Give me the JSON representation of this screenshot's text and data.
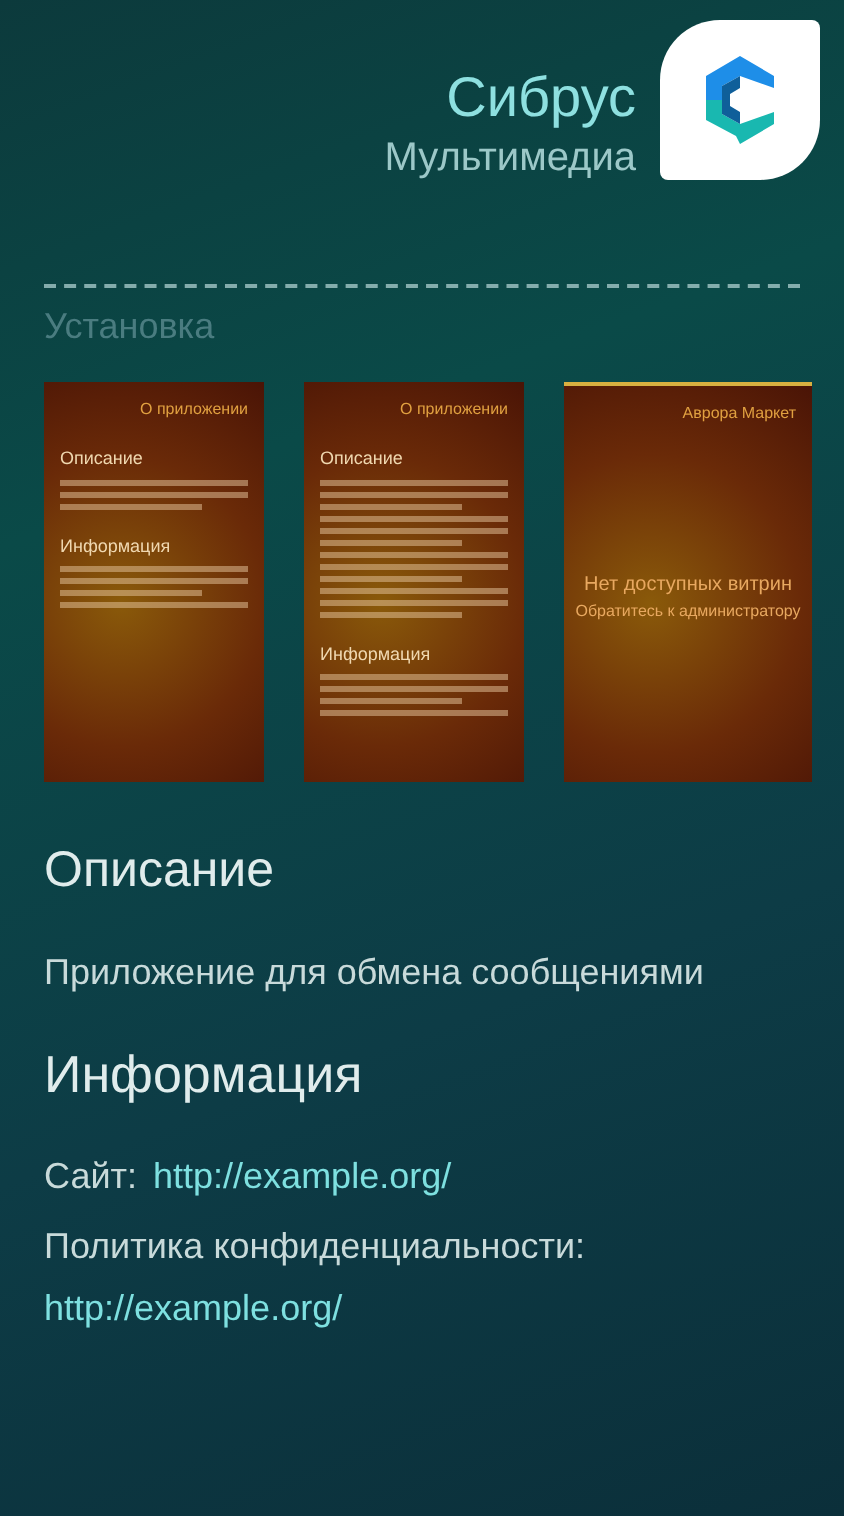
{
  "header": {
    "title": "Сибрус",
    "category": "Мультимедиа"
  },
  "install_label": "Установка",
  "screenshots": [
    {
      "kind": "about_short",
      "header": "О приложении",
      "sections": [
        {
          "title": "Описание"
        },
        {
          "title": "Информация"
        }
      ]
    },
    {
      "kind": "about_long",
      "header": "О приложении",
      "sections": [
        {
          "title": "Описание"
        },
        {
          "title": "Информация"
        }
      ]
    },
    {
      "kind": "empty",
      "header": "Аврора Маркет",
      "message": "Нет доступных витрин",
      "hint": "Обратитесь к администратору"
    }
  ],
  "description": {
    "heading": "Описание",
    "text": "Приложение для обмена сообщениями"
  },
  "info": {
    "heading": "Информация",
    "site_label": "Сайт:",
    "site_link": "http://example.org/",
    "policy_label": "Политика конфиденциальности:",
    "policy_link": "http://example.org/"
  }
}
